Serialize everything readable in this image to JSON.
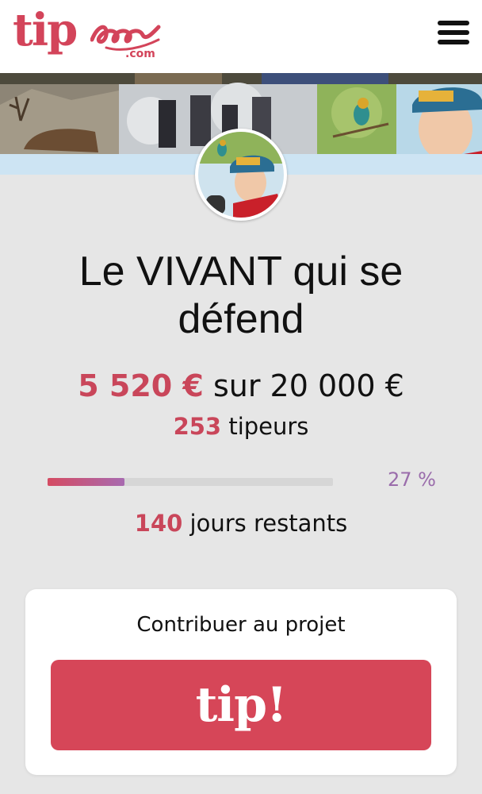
{
  "header": {
    "logo_text": "tip",
    "logo_suffix": ".com",
    "menu_icon": "hamburger-menu-icon"
  },
  "project": {
    "title": "Le VIVANT qui se défend",
    "raised": "5 520 €",
    "goal_text": "sur 20 000 €",
    "tippers_count": "253",
    "tippers_label": "tipeurs",
    "progress_percent": 27,
    "progress_label": "27 %",
    "days_count": "140",
    "days_label": "jours restants"
  },
  "contribute": {
    "label": "Contribuer au projet",
    "button_label": "tip!"
  },
  "colors": {
    "brand": "#d3445a",
    "accent_text": "#c9465a",
    "progress_start": "#d54b62",
    "progress_end": "#a86ab0",
    "percent_text": "#9a6cab",
    "button_bg": "#d64658"
  }
}
